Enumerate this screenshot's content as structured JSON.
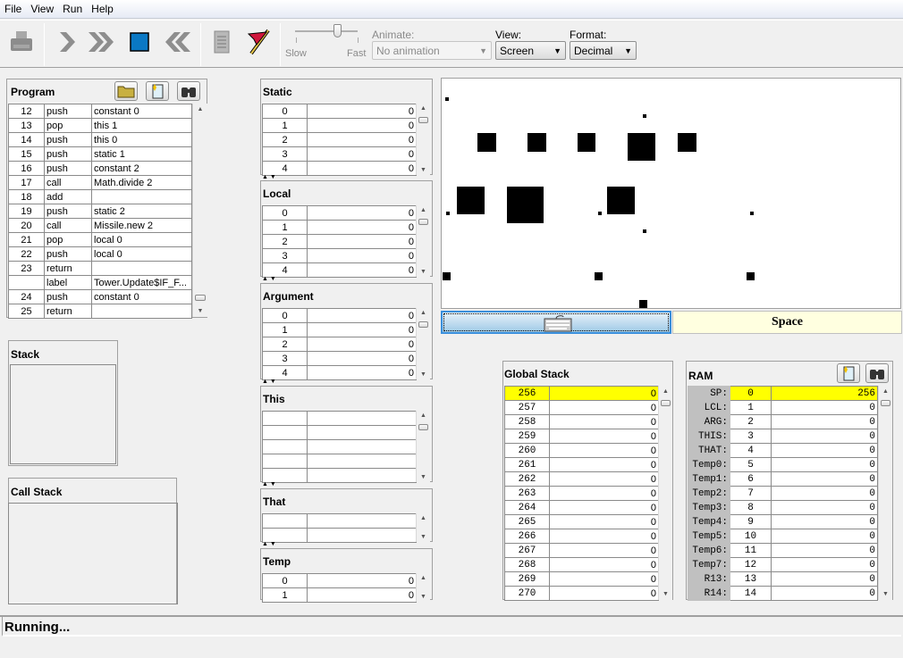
{
  "menu": [
    "File",
    "View",
    "Run",
    "Help"
  ],
  "toolbar": {
    "buttons": [
      {
        "name": "load-program-icon",
        "label": "Load Program"
      },
      {
        "name": "single-step-icon",
        "label": "Single Step"
      },
      {
        "name": "run-icon",
        "label": "Run"
      },
      {
        "name": "stop-icon",
        "label": "Stop"
      },
      {
        "name": "reset-icon",
        "label": "Reset"
      },
      {
        "name": "script-icon",
        "label": "Script"
      },
      {
        "name": "breakpoints-icon",
        "label": "Breakpoints"
      }
    ],
    "speed": {
      "slow_label": "Slow",
      "fast_label": "Fast",
      "value_fraction": 0.75
    },
    "animate": {
      "label": "Animate:",
      "value": "No animation"
    },
    "view": {
      "label": "View:",
      "value": "Screen"
    },
    "format": {
      "label": "Format:",
      "value": "Decimal"
    }
  },
  "program": {
    "title": "Program",
    "rows": [
      {
        "line": "12",
        "cmd": "push",
        "arg": "constant 0"
      },
      {
        "line": "13",
        "cmd": "pop",
        "arg": "this 1"
      },
      {
        "line": "14",
        "cmd": "push",
        "arg": "this 0"
      },
      {
        "line": "15",
        "cmd": "push",
        "arg": "static 1"
      },
      {
        "line": "16",
        "cmd": "push",
        "arg": "constant 2"
      },
      {
        "line": "17",
        "cmd": "call",
        "arg": "Math.divide 2"
      },
      {
        "line": "18",
        "cmd": "add",
        "arg": ""
      },
      {
        "line": "19",
        "cmd": "push",
        "arg": "static 2"
      },
      {
        "line": "20",
        "cmd": "call",
        "arg": "Missile.new 2"
      },
      {
        "line": "21",
        "cmd": "pop",
        "arg": "local 0"
      },
      {
        "line": "22",
        "cmd": "push",
        "arg": "local 0"
      },
      {
        "line": "23",
        "cmd": "return",
        "arg": ""
      },
      {
        "line": "",
        "cmd": "label",
        "arg": "Tower.Update$IF_F..."
      },
      {
        "line": "24",
        "cmd": "push",
        "arg": "constant 0"
      },
      {
        "line": "25",
        "cmd": "return",
        "arg": ""
      }
    ]
  },
  "stack": {
    "title": "Stack"
  },
  "call_stack": {
    "title": "Call Stack"
  },
  "segments": {
    "static": {
      "title": "Static",
      "rows": [
        [
          "0",
          "0"
        ],
        [
          "1",
          "0"
        ],
        [
          "2",
          "0"
        ],
        [
          "3",
          "0"
        ],
        [
          "4",
          "0"
        ]
      ]
    },
    "local": {
      "title": "Local",
      "rows": [
        [
          "0",
          "0"
        ],
        [
          "1",
          "0"
        ],
        [
          "2",
          "0"
        ],
        [
          "3",
          "0"
        ],
        [
          "4",
          "0"
        ]
      ]
    },
    "argument": {
      "title": "Argument",
      "rows": [
        [
          "0",
          "0"
        ],
        [
          "1",
          "0"
        ],
        [
          "2",
          "0"
        ],
        [
          "3",
          "0"
        ],
        [
          "4",
          "0"
        ]
      ]
    },
    "this": {
      "title": "This",
      "rows": [
        [
          "",
          ""
        ],
        [
          "",
          ""
        ],
        [
          "",
          ""
        ],
        [
          "",
          ""
        ],
        [
          "",
          ""
        ]
      ]
    },
    "that": {
      "title": "That",
      "rows": [
        [
          "",
          ""
        ],
        [
          "",
          ""
        ]
      ]
    },
    "temp": {
      "title": "Temp",
      "rows": [
        [
          "0",
          "0"
        ],
        [
          "1",
          "0"
        ]
      ]
    }
  },
  "keyboard": {
    "key_label": "Space"
  },
  "global_stack": {
    "title": "Global Stack",
    "rows": [
      [
        "256",
        "0"
      ],
      [
        "257",
        "0"
      ],
      [
        "258",
        "0"
      ],
      [
        "259",
        "0"
      ],
      [
        "260",
        "0"
      ],
      [
        "261",
        "0"
      ],
      [
        "262",
        "0"
      ],
      [
        "263",
        "0"
      ],
      [
        "264",
        "0"
      ],
      [
        "265",
        "0"
      ],
      [
        "266",
        "0"
      ],
      [
        "267",
        "0"
      ],
      [
        "268",
        "0"
      ],
      [
        "269",
        "0"
      ],
      [
        "270",
        "0"
      ]
    ],
    "highlight_index": 0
  },
  "ram": {
    "title": "RAM",
    "rows": [
      [
        "SP:",
        "0",
        "256"
      ],
      [
        "LCL:",
        "1",
        "0"
      ],
      [
        "ARG:",
        "2",
        "0"
      ],
      [
        "THIS:",
        "3",
        "0"
      ],
      [
        "THAT:",
        "4",
        "0"
      ],
      [
        "Temp0:",
        "5",
        "0"
      ],
      [
        "Temp1:",
        "6",
        "0"
      ],
      [
        "Temp2:",
        "7",
        "0"
      ],
      [
        "Temp3:",
        "8",
        "0"
      ],
      [
        "Temp4:",
        "9",
        "0"
      ],
      [
        "Temp5:",
        "10",
        "0"
      ],
      [
        "Temp6:",
        "11",
        "0"
      ],
      [
        "Temp7:",
        "12",
        "0"
      ],
      [
        "R13:",
        "13",
        "0"
      ],
      [
        "R14:",
        "14",
        "0"
      ]
    ],
    "highlight_index": 0
  },
  "status": {
    "message": "Running..."
  }
}
